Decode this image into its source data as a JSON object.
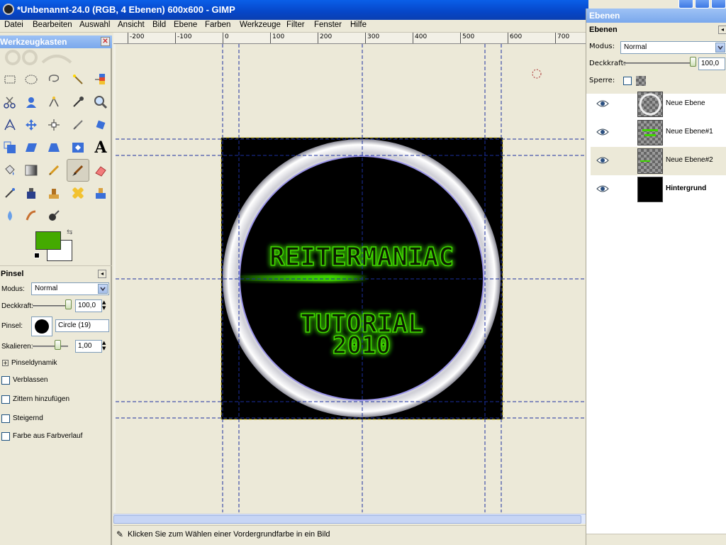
{
  "window": {
    "title": "*Unbenannt-24.0 (RGB, 4 Ebenen) 600x600 - GIMP"
  },
  "menu": [
    "Datei",
    "Bearbeiten",
    "Auswahl",
    "Ansicht",
    "Bild",
    "Ebene",
    "Farben",
    "Werkzeuge",
    "Filter",
    "Fenster",
    "Hilfe"
  ],
  "toolbox": {
    "title": "Werkzeugkasten",
    "fg_color": "#44aa00",
    "bg_color": "#ffffff",
    "tools": [
      "rect-select",
      "ellipse-select",
      "free-select",
      "fuzzy-select",
      "select-by-color",
      "scissors",
      "foreground-select",
      "paths",
      "color-picker",
      "zoom",
      "measure",
      "move",
      "align",
      "crop",
      "rotate",
      "scale",
      "shear",
      "perspective",
      "flip",
      "text",
      "bucket-fill",
      "blend",
      "pencil",
      "paintbrush",
      "eraser",
      "airbrush",
      "ink",
      "clone",
      "heal",
      "perspective-clone",
      "blur",
      "smudge",
      "dodge-burn"
    ]
  },
  "tool_options": {
    "title": "Pinsel",
    "mode_label": "Modus:",
    "mode_value": "Normal",
    "opacity_label": "Deckkraft:",
    "opacity_value": "100,0",
    "brush_label": "Pinsel:",
    "brush_name": "Circle (19)",
    "scale_label": "Skalieren:",
    "scale_value": "1,00",
    "dynamics_label": "Pinseldynamik",
    "checkboxes": [
      {
        "label": "Verblassen",
        "checked": false
      },
      {
        "label": "Zittern hinzufügen",
        "checked": false
      },
      {
        "label": "Steigernd",
        "checked": false
      },
      {
        "label": "Farbe aus Farbverlauf",
        "checked": false
      }
    ]
  },
  "ruler_labels": [
    "-200",
    "-100",
    "0",
    "100",
    "200",
    "300",
    "400",
    "500",
    "600",
    "700"
  ],
  "canvas_art": {
    "line1": "REITERMANIAC",
    "line2": "TUTORIAL",
    "line3": "2010",
    "glow_color": "#3fd600"
  },
  "status_bar": {
    "message": "Klicken Sie zum Wählen einer Vordergrundfarbe in ein Bild"
  },
  "layers_panel": {
    "window_title": "Ebenen",
    "title": "Ebenen",
    "mode_label": "Modus:",
    "mode_value": "Normal",
    "opacity_label": "Deckkraft:",
    "opacity_value": "100,0",
    "lock_label": "Sperre:",
    "layers": [
      {
        "name": "Neue Ebene",
        "visible": true,
        "active": false
      },
      {
        "name": "Neue Ebene#1",
        "visible": true,
        "active": false
      },
      {
        "name": "Neue Ebene#2",
        "visible": true,
        "active": true
      },
      {
        "name": "Hintergrund",
        "visible": true,
        "active": false
      }
    ]
  }
}
